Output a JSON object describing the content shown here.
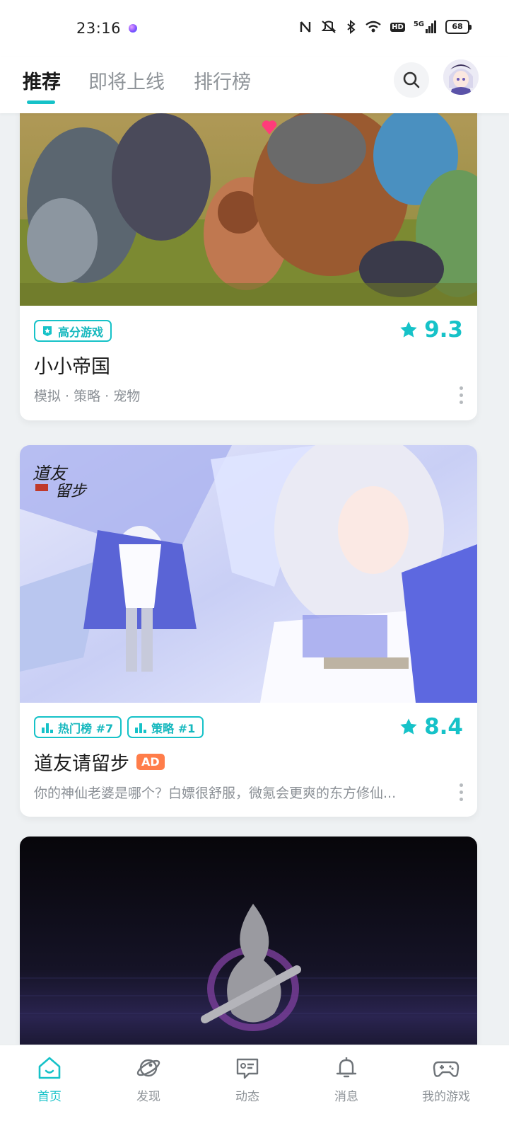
{
  "status_bar": {
    "time": "23:16",
    "network": "5G",
    "hd": "HD",
    "battery": "68"
  },
  "top_nav": {
    "tabs": [
      {
        "label": "推荐",
        "active": true
      },
      {
        "label": "即将上线",
        "active": false
      },
      {
        "label": "排行榜",
        "active": false
      }
    ]
  },
  "cards": [
    {
      "badges": [
        "高分游戏"
      ],
      "rating": "9.3",
      "title": "小小帝国",
      "desc": "模拟 · 策略 · 宠物"
    },
    {
      "badges": [
        "热门榜 #7",
        "策略 #1"
      ],
      "rating": "8.4",
      "title": "道友请留步",
      "ad": "AD",
      "desc": "你的神仙老婆是哪个？白嫖很舒服，微氪会更爽的东方修仙..."
    }
  ],
  "bottom_nav": {
    "items": [
      {
        "label": "首页",
        "icon": "home-icon",
        "active": true
      },
      {
        "label": "发现",
        "icon": "planet-icon",
        "active": false
      },
      {
        "label": "动态",
        "icon": "chat-icon",
        "active": false
      },
      {
        "label": "消息",
        "icon": "bell-icon",
        "active": false
      },
      {
        "label": "我的游戏",
        "icon": "gamepad-icon",
        "active": false
      }
    ]
  },
  "colors": {
    "accent": "#16c2c8",
    "ad": "#ff7d4a",
    "text": "#1c1c1c",
    "muted": "#8e9398"
  }
}
